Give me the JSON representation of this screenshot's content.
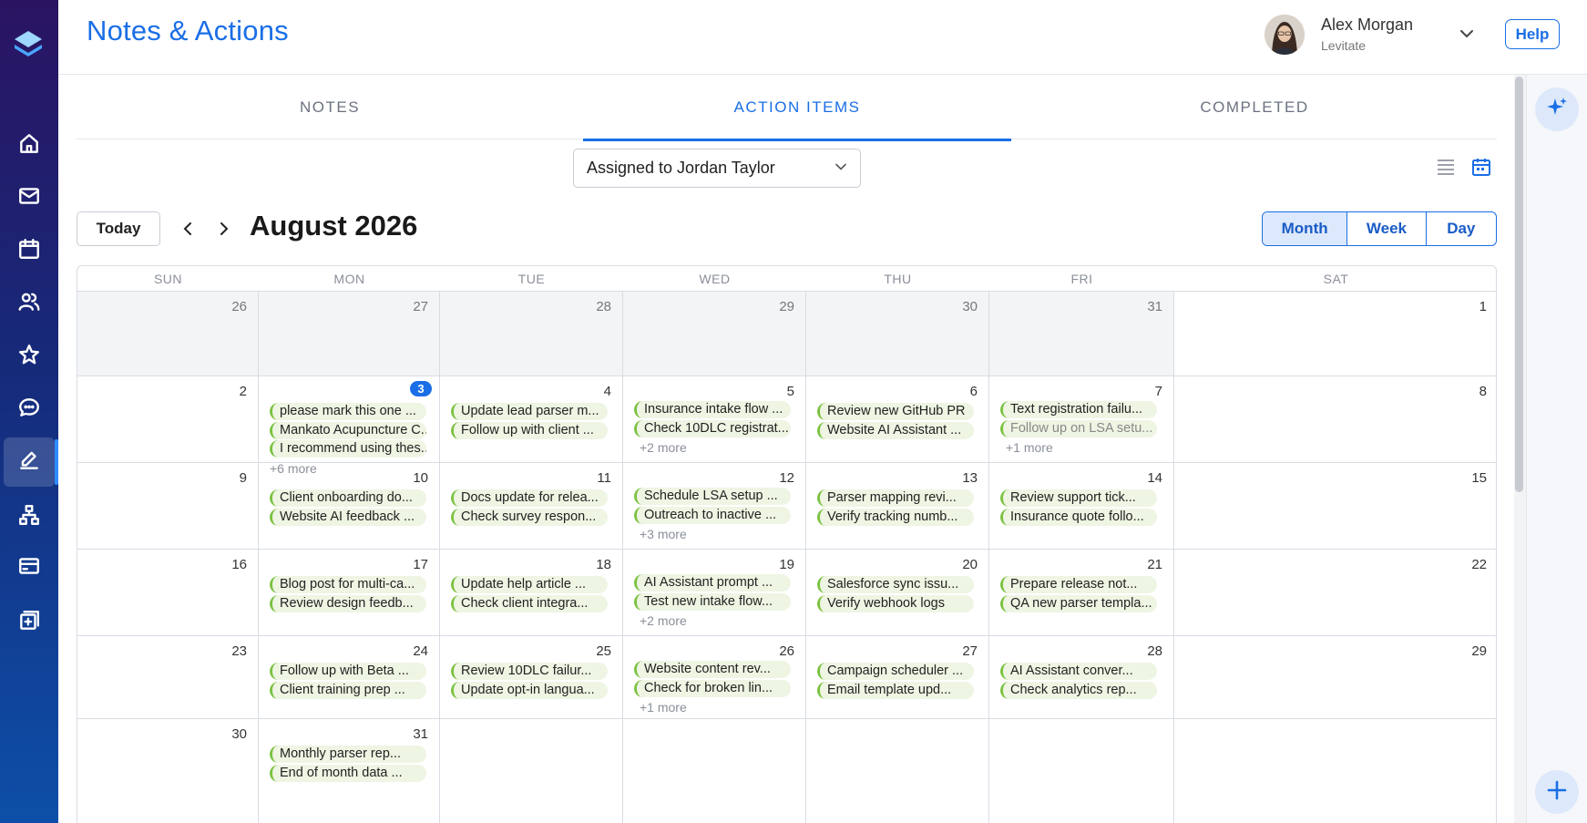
{
  "header": {
    "title": "Notes & Actions",
    "user_name": "Alex Morgan",
    "user_org": "Levitate",
    "help_label": "Help"
  },
  "tabs": [
    {
      "label": "NOTES"
    },
    {
      "label": "ACTION ITEMS"
    },
    {
      "label": "COMPLETED"
    }
  ],
  "filter": {
    "value": "Assigned to Jordan Taylor"
  },
  "toolbar": {
    "today_label": "Today",
    "month_title": "August 2026",
    "views": [
      "Month",
      "Week",
      "Day"
    ],
    "active_view": "Month"
  },
  "calendar": {
    "weekdays": [
      "SUN",
      "MON",
      "TUE",
      "WED",
      "THU",
      "FRI",
      "SAT"
    ],
    "weeks": [
      [
        {
          "day": "26",
          "out": true,
          "events": []
        },
        {
          "day": "27",
          "out": true,
          "events": []
        },
        {
          "day": "28",
          "out": true,
          "events": []
        },
        {
          "day": "29",
          "out": true,
          "events": []
        },
        {
          "day": "30",
          "out": true,
          "events": []
        },
        {
          "day": "31",
          "out": true,
          "events": []
        },
        {
          "day": "1",
          "events": []
        }
      ],
      [
        {
          "day": "2",
          "events": []
        },
        {
          "day": "3",
          "today": true,
          "events": [
            "please mark this one ...",
            "Mankato Acupuncture C...",
            "I recommend using thes..."
          ],
          "more": "+6 more"
        },
        {
          "day": "4",
          "events": [
            "Update lead parser m...",
            "Follow up with client ..."
          ]
        },
        {
          "day": "5",
          "events": [
            "Insurance intake flow ...",
            "Check 10DLC registrat..."
          ],
          "more": "+2 more"
        },
        {
          "day": "6",
          "events": [
            "Review new GitHub PR",
            "Website AI Assistant ..."
          ]
        },
        {
          "day": "7",
          "events": [
            "Text registration failu...",
            "Follow up on LSA setu..."
          ],
          "faded": [
            1
          ],
          "more": "+1 more"
        },
        {
          "day": "8",
          "events": []
        }
      ],
      [
        {
          "day": "9",
          "events": []
        },
        {
          "day": "10",
          "events": [
            "Client onboarding do...",
            "Website AI feedback ..."
          ]
        },
        {
          "day": "11",
          "events": [
            "Docs update for relea...",
            "Check survey respon..."
          ]
        },
        {
          "day": "12",
          "events": [
            "Schedule LSA setup ...",
            "Outreach to inactive ..."
          ],
          "more": "+3 more"
        },
        {
          "day": "13",
          "events": [
            "Parser mapping revi...",
            "Verify tracking numb..."
          ]
        },
        {
          "day": "14",
          "events": [
            "Review support tick...",
            "Insurance quote follo..."
          ]
        },
        {
          "day": "15",
          "events": []
        }
      ],
      [
        {
          "day": "16",
          "events": []
        },
        {
          "day": "17",
          "events": [
            "Blog post for multi-ca...",
            "Review design feedb..."
          ]
        },
        {
          "day": "18",
          "events": [
            "Update help article ...",
            "Check client integra..."
          ]
        },
        {
          "day": "19",
          "events": [
            "AI Assistant prompt ...",
            "Test new intake flow..."
          ],
          "more": "+2 more"
        },
        {
          "day": "20",
          "events": [
            "Salesforce sync issu...",
            "Verify webhook logs"
          ]
        },
        {
          "day": "21",
          "events": [
            "Prepare release not...",
            "QA new parser templa..."
          ]
        },
        {
          "day": "22",
          "events": []
        }
      ],
      [
        {
          "day": "23",
          "events": []
        },
        {
          "day": "24",
          "events": [
            "Follow up with Beta ...",
            "Client training prep ..."
          ]
        },
        {
          "day": "25",
          "events": [
            "Review 10DLC failur...",
            "Update opt-in langua..."
          ]
        },
        {
          "day": "26",
          "events": [
            "Website content rev...",
            "Check for broken lin..."
          ],
          "more": "+1 more"
        },
        {
          "day": "27",
          "events": [
            "Campaign scheduler ...",
            "Email template upd..."
          ]
        },
        {
          "day": "28",
          "events": [
            "AI Assistant conver...",
            "Check analytics rep..."
          ]
        },
        {
          "day": "29",
          "events": []
        }
      ],
      [
        {
          "day": "30",
          "events": []
        },
        {
          "day": "31",
          "events": [
            "Monthly parser rep...",
            "End of month data ..."
          ]
        },
        {
          "day": "",
          "events": []
        },
        {
          "day": "",
          "events": []
        },
        {
          "day": "",
          "events": []
        },
        {
          "day": "",
          "events": []
        },
        {
          "day": "",
          "events": []
        }
      ]
    ]
  },
  "icons": {
    "sidebar": [
      "logo-icon",
      "home-icon",
      "mail-icon",
      "calendar-icon",
      "people-icon",
      "star-icon",
      "chat-icon",
      "edit-icon",
      "org-chart-icon",
      "card-icon",
      "add-square-icon"
    ],
    "right_rail": [
      "sparkle-icon",
      "plus-icon"
    ]
  },
  "colors": {
    "accent": "#1a6ee6",
    "event_bg": "#eef5e3",
    "event_bar": "#7cc242",
    "sidebar_top": "#2a1462",
    "sidebar_bottom": "#0d4fa8"
  }
}
